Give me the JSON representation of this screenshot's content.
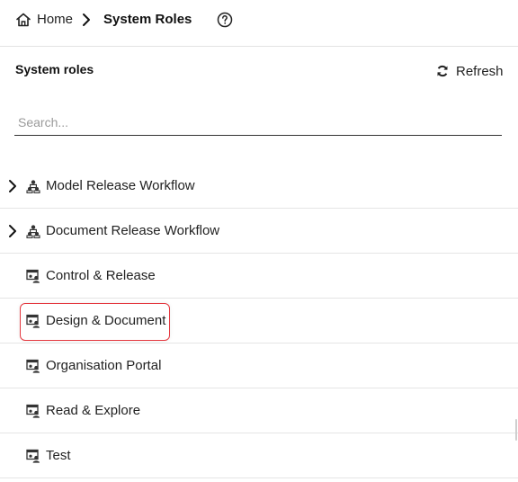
{
  "breadcrumb": {
    "home_label": "Home",
    "current_label": "System Roles"
  },
  "panel": {
    "title": "System roles",
    "refresh_label": "Refresh"
  },
  "search": {
    "placeholder": "Search...",
    "value": ""
  },
  "roles": [
    {
      "label": "Model Release Workflow",
      "expandable": true,
      "icon": "workflow-group-icon"
    },
    {
      "label": "Document Release Workflow",
      "expandable": true,
      "icon": "workflow-group-icon"
    },
    {
      "label": "Control & Release",
      "expandable": false,
      "icon": "role-icon"
    },
    {
      "label": "Design & Document",
      "expandable": false,
      "icon": "role-icon",
      "highlighted": true
    },
    {
      "label": "Organisation Portal",
      "expandable": false,
      "icon": "role-icon"
    },
    {
      "label": "Read & Explore",
      "expandable": false,
      "icon": "role-icon"
    },
    {
      "label": "Test",
      "expandable": false,
      "icon": "role-icon"
    }
  ],
  "colors": {
    "highlight": "#e4383f",
    "divider": "#e5e5e5"
  }
}
